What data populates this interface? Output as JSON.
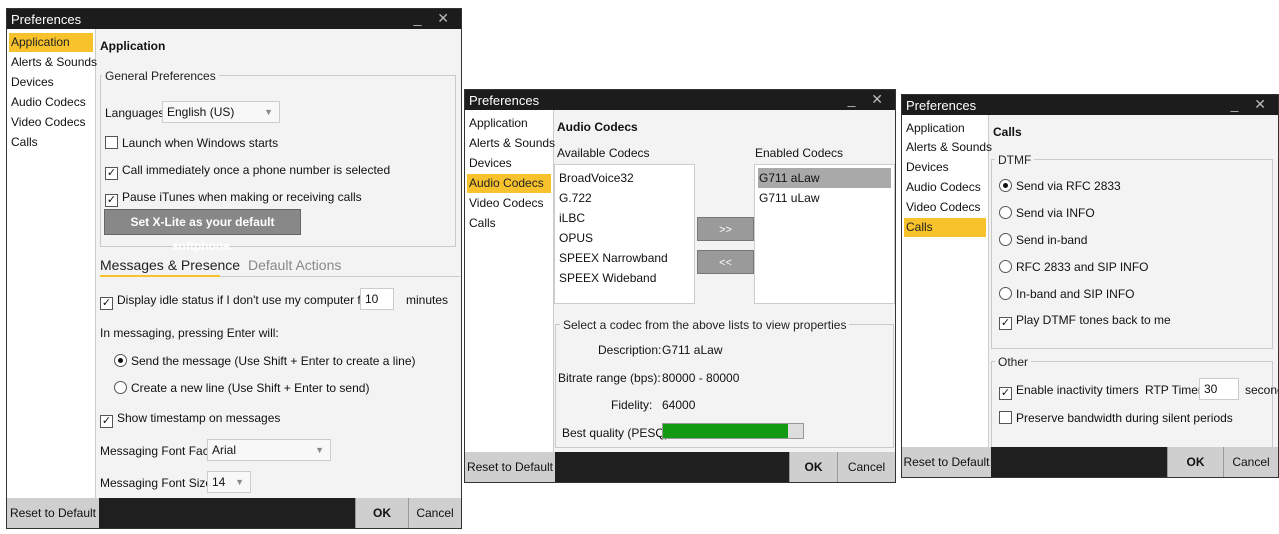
{
  "windows": {
    "app": {
      "title": "Preferences",
      "window_controls": "_ ✕",
      "sidebar": [
        "Application",
        "Alerts & Sounds",
        "Devices",
        "Audio Codecs",
        "Video Codecs",
        "Calls"
      ],
      "heading": "Application",
      "general_group_label": "General Preferences",
      "languages_label": "Languages:",
      "languages_value": "English (US)",
      "launch_windows": "Launch when Windows starts",
      "call_immediately": "Call immediately once a phone number is selected",
      "pause_itunes": "Pause iTunes when making or receiving calls",
      "default_softphone": "Set X-Lite as your default softphone.",
      "tab_messages": "Messages & Presence",
      "tab_default_actions": "Default Actions",
      "idle_status": "Display idle status if I don't use my computer for:",
      "idle_minutes_value": "10",
      "minutes_label": "minutes",
      "enter_label": "In messaging, pressing Enter will:",
      "send_message": "Send the message (Use Shift + Enter to create a line)",
      "new_line": "Create a new line (Use Shift + Enter to send)",
      "show_timestamp": "Show timestamp on messages",
      "font_face_label": "Messaging Font Face:",
      "font_face_value": "Arial",
      "font_size_label": "Messaging Font Size:",
      "font_size_value": "14",
      "reset": "Reset to Default",
      "ok": "OK",
      "cancel": "Cancel"
    },
    "audio": {
      "title": "Preferences",
      "window_controls": "_ ✕",
      "sidebar": [
        "Application",
        "Alerts & Sounds",
        "Devices",
        "Audio Codecs",
        "Video Codecs",
        "Calls"
      ],
      "heading": "Audio Codecs",
      "available_label": "Available Codecs",
      "enabled_label": "Enabled Codecs",
      "available": [
        "BroadVoice32",
        "G.722",
        "iLBC",
        "OPUS",
        "SPEEX Narrowband",
        "SPEEX Wideband"
      ],
      "enabled": [
        "G711 aLaw",
        "G711 uLaw"
      ],
      "add_btn": ">>",
      "remove_btn": "<<",
      "props_group_label": "Select a codec from the above lists to view properties",
      "description_label": "Description:",
      "description_value": "G711 aLaw",
      "bitrate_label": "Bitrate range (bps):",
      "bitrate_value": "80000 - 80000",
      "fidelity_label": "Fidelity:",
      "fidelity_value": "64000",
      "quality_label": "Best quality (PESQ):",
      "quality_fraction": 0.89,
      "reset": "Reset to Default",
      "ok": "OK",
      "cancel": "Cancel"
    },
    "calls": {
      "title": "Preferences",
      "window_controls": "_ ✕",
      "sidebar": [
        "Application",
        "Alerts & Sounds",
        "Devices",
        "Audio Codecs",
        "Video Codecs",
        "Calls"
      ],
      "heading": "Calls",
      "dtmf_group_label": "DTMF",
      "dtmf_options": [
        "Send via RFC 2833",
        "Send via INFO",
        "Send in-band",
        "RFC 2833 and SIP INFO",
        "In-band and SIP INFO"
      ],
      "play_dtmf": "Play DTMF tones back to me",
      "other_group_label": "Other",
      "inactivity": "Enable inactivity timers",
      "rtp_timer_label": "RTP Timer:",
      "rtp_timer_value": "30",
      "seconds_label": "seconds",
      "preserve_bw": "Preserve bandwidth during silent periods",
      "reset": "Reset to Default",
      "ok": "OK",
      "cancel": "Cancel"
    }
  },
  "colors": {
    "selected": "#f7c22c",
    "titlebar": "#1c1c1c",
    "quality_bar": "#129a12"
  }
}
